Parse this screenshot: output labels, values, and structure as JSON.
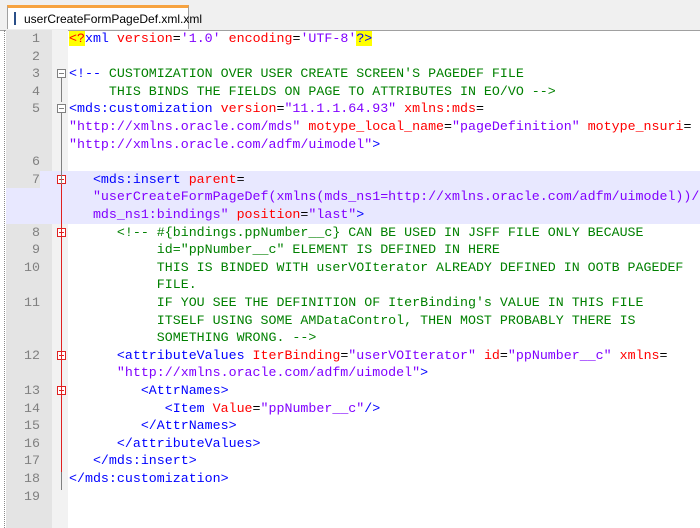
{
  "tab": {
    "title": "userCreateFormPageDef.xml.xml",
    "icon": "save-icon"
  },
  "colors": {
    "tag": "#0000ff",
    "attr": "#ff0000",
    "value": "#8000ff",
    "comment": "#008000",
    "highlight": "#e8e8ff"
  },
  "rows": [
    {
      "n": "1",
      "s": [
        [
          "y",
          "<?"
        ],
        [
          "b",
          "xml "
        ],
        [
          "r",
          "version"
        ],
        [
          "k",
          "="
        ],
        [
          "v",
          "'1.0' "
        ],
        [
          "r",
          "encoding"
        ],
        [
          "k",
          "="
        ],
        [
          "v",
          "'UTF-8'"
        ],
        [
          "yb",
          "?>"
        ]
      ]
    },
    {
      "n": "2",
      "s": []
    },
    {
      "n": "3",
      "s": [
        [
          "b",
          "<!-- "
        ],
        [
          "g",
          "CUSTOMIZATION OVER USER CREATE SCREEN'S PAGEDEF FILE"
        ]
      ]
    },
    {
      "n": "4",
      "s": [
        [
          "g",
          "     THIS BINDS THE FIELDS ON PAGE TO ATTRIBUTES IN EO/VO -->"
        ]
      ]
    },
    {
      "n": "5",
      "s": [
        [
          "b",
          "<mds:customization "
        ],
        [
          "r",
          "version"
        ],
        [
          "k",
          "="
        ],
        [
          "v",
          "\"11.1.1.64.93\" "
        ],
        [
          "r",
          "xmlns:mds"
        ],
        [
          "k",
          "="
        ]
      ]
    },
    {
      "n": "",
      "s": [
        [
          "v",
          "\"http://xmlns.oracle.com/mds\" "
        ],
        [
          "r",
          "motype_local_name"
        ],
        [
          "k",
          "="
        ],
        [
          "v",
          "\"pageDefinition\" "
        ],
        [
          "r",
          "motype_nsuri"
        ],
        [
          "k",
          "="
        ]
      ]
    },
    {
      "n": "",
      "s": [
        [
          "v",
          "\"http://xmlns.oracle.com/adfm/uimodel\""
        ],
        [
          "b",
          ">"
        ]
      ]
    },
    {
      "n": "6",
      "s": []
    },
    {
      "n": "7",
      "hl": true,
      "s": [
        [
          "b",
          "   <mds:insert "
        ],
        [
          "r",
          "parent"
        ],
        [
          "k",
          "="
        ]
      ]
    },
    {
      "n": "",
      "hl": true,
      "s": [
        [
          "v",
          "   \"userCreateFormPageDef(xmlns(mds_ns1=http://xmlns.oracle.com/adfm/uimodel))/"
        ]
      ]
    },
    {
      "n": "",
      "hl": true,
      "s": [
        [
          "v",
          "   mds_ns1:bindings\" "
        ],
        [
          "r",
          "position"
        ],
        [
          "k",
          "="
        ],
        [
          "v",
          "\"last\""
        ],
        [
          "b",
          ">"
        ]
      ]
    },
    {
      "n": "8",
      "s": [
        [
          "g",
          "      <!-- #{bindings.ppNumber__c} CAN BE USED IN JSFF FILE ONLY BECAUSE"
        ]
      ]
    },
    {
      "n": "9",
      "s": [
        [
          "g",
          "           id=\"ppNumber__c\" ELEMENT IS DEFINED IN HERE"
        ]
      ]
    },
    {
      "n": "10",
      "s": [
        [
          "g",
          "           THIS IS BINDED WITH userVOIterator ALREADY DEFINED IN OOTB PAGEDEF"
        ]
      ]
    },
    {
      "n": "",
      "s": [
        [
          "g",
          "           FILE."
        ]
      ]
    },
    {
      "n": "11",
      "s": [
        [
          "g",
          "           IF YOU SEE THE DEFINITION OF IterBinding's VALUE IN THIS FILE"
        ]
      ]
    },
    {
      "n": "",
      "s": [
        [
          "g",
          "           ITSELF USING SOME AMDataControl, THEN MOST PROBABLY THERE IS"
        ]
      ]
    },
    {
      "n": "",
      "s": [
        [
          "g",
          "           SOMETHING WRONG. -->"
        ]
      ]
    },
    {
      "n": "12",
      "s": [
        [
          "b",
          "      <attributeValues "
        ],
        [
          "r",
          "IterBinding"
        ],
        [
          "k",
          "="
        ],
        [
          "v",
          "\"userVOIterator\" "
        ],
        [
          "r",
          "id"
        ],
        [
          "k",
          "="
        ],
        [
          "v",
          "\"ppNumber__c\" "
        ],
        [
          "r",
          "xmlns"
        ],
        [
          "k",
          "="
        ]
      ]
    },
    {
      "n": "",
      "s": [
        [
          "v",
          "      \"http://xmlns.oracle.com/adfm/uimodel\""
        ],
        [
          "b",
          ">"
        ]
      ]
    },
    {
      "n": "13",
      "s": [
        [
          "b",
          "         <AttrNames>"
        ]
      ]
    },
    {
      "n": "14",
      "s": [
        [
          "b",
          "            <Item "
        ],
        [
          "r",
          "Value"
        ],
        [
          "k",
          "="
        ],
        [
          "v",
          "\"ppNumber__c\""
        ],
        [
          "b",
          "/>"
        ]
      ]
    },
    {
      "n": "15",
      "s": [
        [
          "b",
          "         </AttrNames>"
        ]
      ]
    },
    {
      "n": "16",
      "s": [
        [
          "b",
          "      </attributeValues>"
        ]
      ]
    },
    {
      "n": "17",
      "s": [
        [
          "b",
          "   </mds:insert>"
        ]
      ]
    },
    {
      "n": "18",
      "s": [
        [
          "b",
          "</mds:customization>"
        ]
      ]
    },
    {
      "n": "19",
      "s": []
    }
  ]
}
